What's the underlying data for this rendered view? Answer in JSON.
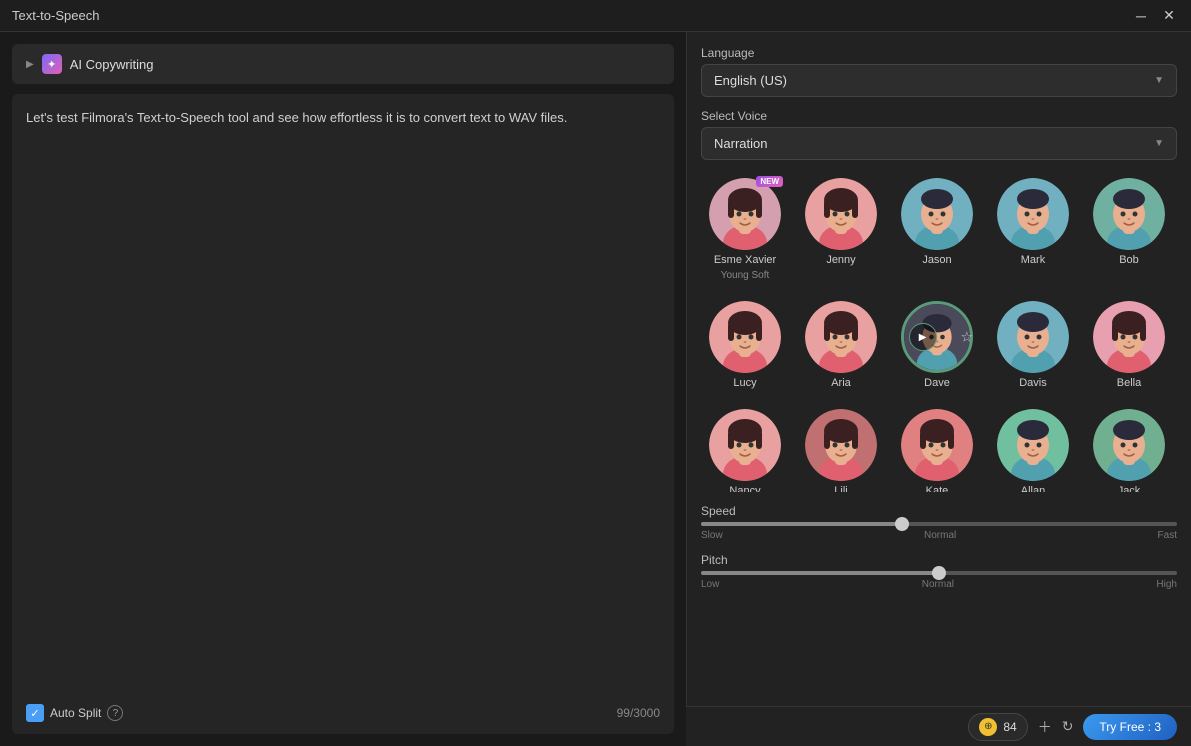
{
  "window": {
    "title": "Text-to-Speech"
  },
  "ai_bar": {
    "label": "AI Copywriting"
  },
  "textarea": {
    "content": "Let's test Filmora's Text-to-Speech tool and see how effortless it is to convert text to WAV files.",
    "char_count": "99/3000"
  },
  "auto_split": {
    "label": "Auto Split"
  },
  "right_panel": {
    "language_label": "Language",
    "language_value": "English (US)",
    "voice_label": "Select Voice",
    "voice_value": "Narration"
  },
  "voices": [
    {
      "name": "Esme Xavier",
      "subtitle": "Young Soft",
      "is_new": true,
      "selected": false,
      "gender": "female",
      "color1": "#d4a0b0",
      "color2": "#c07a9a"
    },
    {
      "name": "Jenny",
      "subtitle": "",
      "is_new": false,
      "selected": false,
      "gender": "female",
      "color1": "#e8a0a0",
      "color2": "#c06060"
    },
    {
      "name": "Jason",
      "subtitle": "",
      "is_new": false,
      "selected": false,
      "gender": "male",
      "color1": "#70b0c0",
      "color2": "#4a8fa0"
    },
    {
      "name": "Mark",
      "subtitle": "",
      "is_new": false,
      "selected": false,
      "gender": "male",
      "color1": "#70b0c0",
      "color2": "#4a8fa0"
    },
    {
      "name": "Bob",
      "subtitle": "",
      "is_new": false,
      "selected": false,
      "gender": "male",
      "color1": "#70b0a0",
      "color2": "#4a8f7a"
    },
    {
      "name": "Lucy",
      "subtitle": "",
      "is_new": false,
      "selected": false,
      "gender": "female",
      "color1": "#e8a0a0",
      "color2": "#c06060"
    },
    {
      "name": "Aria",
      "subtitle": "",
      "is_new": false,
      "selected": false,
      "gender": "female",
      "color1": "#e8a0a0",
      "color2": "#c06060"
    },
    {
      "name": "Dave",
      "subtitle": "",
      "is_new": false,
      "selected": true,
      "gender": "male",
      "color1": "#4a4a5a",
      "color2": "#3a3a4a"
    },
    {
      "name": "Davis",
      "subtitle": "",
      "is_new": false,
      "selected": false,
      "gender": "male",
      "color1": "#70b0c0",
      "color2": "#4a8fa0"
    },
    {
      "name": "Bella",
      "subtitle": "",
      "is_new": false,
      "selected": false,
      "gender": "female",
      "color1": "#e8a0b0",
      "color2": "#c07080"
    },
    {
      "name": "Nancy",
      "subtitle": "",
      "is_new": false,
      "selected": false,
      "gender": "female",
      "color1": "#e8a0a0",
      "color2": "#c06060"
    },
    {
      "name": "Lili",
      "subtitle": "",
      "is_new": false,
      "selected": false,
      "gender": "female",
      "color1": "#c07070",
      "color2": "#a05050"
    },
    {
      "name": "Kate",
      "subtitle": "",
      "is_new": false,
      "selected": false,
      "gender": "female",
      "color1": "#e08080",
      "color2": "#c05050"
    },
    {
      "name": "Allan",
      "subtitle": "",
      "is_new": false,
      "selected": false,
      "gender": "male",
      "color1": "#70c0a0",
      "color2": "#4aa080"
    },
    {
      "name": "Jack",
      "subtitle": "",
      "is_new": false,
      "selected": false,
      "gender": "male",
      "color1": "#70b090",
      "color2": "#4a9060"
    }
  ],
  "speed": {
    "label": "Speed",
    "min": "Slow",
    "mid": "Normal",
    "max": "Fast",
    "value": 42
  },
  "pitch": {
    "label": "Pitch",
    "min": "Low",
    "mid": "Normal",
    "max": "High",
    "value": 50
  },
  "bottom_bar": {
    "credits": "84",
    "try_free_label": "Try Free : 3"
  }
}
